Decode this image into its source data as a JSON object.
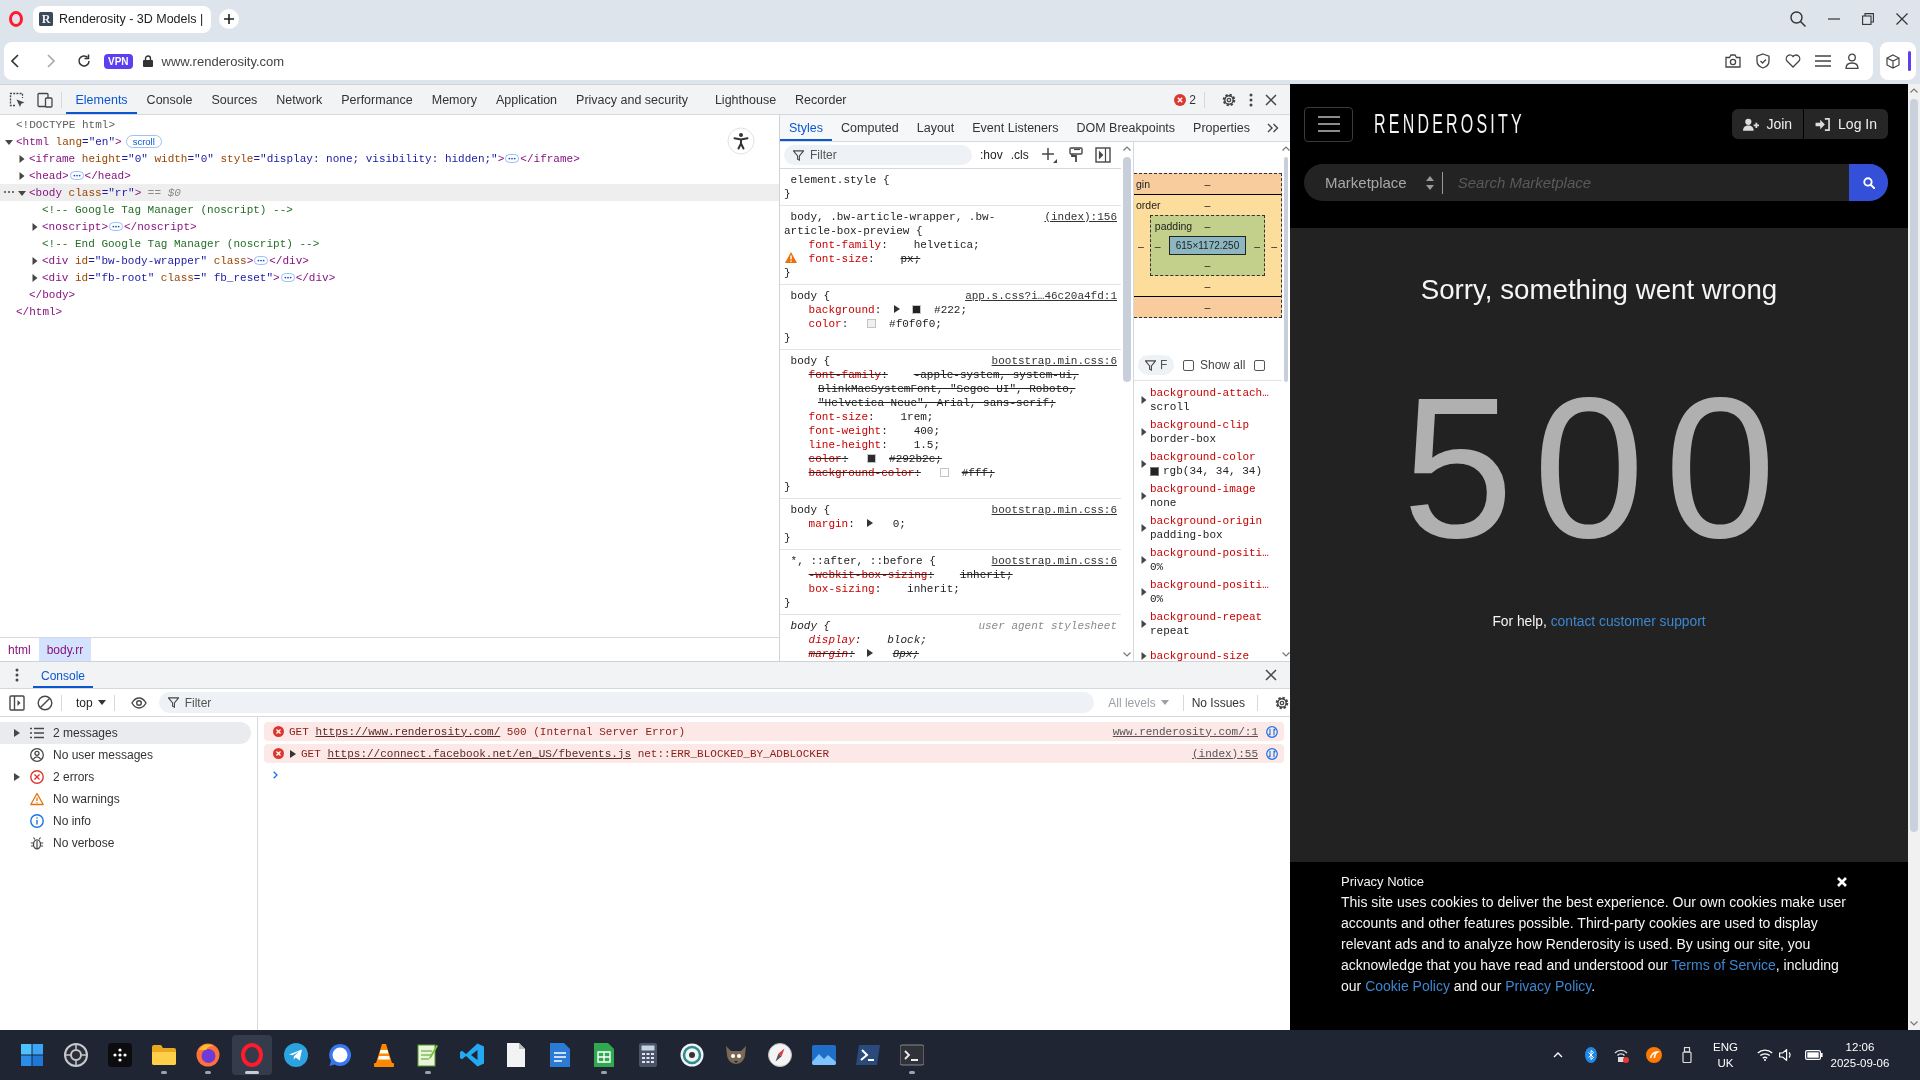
{
  "browser": {
    "tab": {
      "favicon": "R",
      "title": "Renderosity - 3D Models |"
    },
    "address_bar": {
      "vpn_badge": "VPN",
      "url": "www.renderosity.com"
    }
  },
  "devtools": {
    "tabs": [
      {
        "label": "Elements",
        "selected": true
      },
      {
        "label": "Console",
        "selected": false
      },
      {
        "label": "Sources",
        "selected": false
      },
      {
        "label": "Network",
        "selected": false
      },
      {
        "label": "Performance",
        "selected": false
      },
      {
        "label": "Memory",
        "selected": false
      },
      {
        "label": "Application",
        "selected": false
      },
      {
        "label": "Privacy and security",
        "selected": false
      },
      {
        "label": "Lighthouse",
        "selected": false
      },
      {
        "label": "Recorder",
        "selected": false
      }
    ],
    "error_count": "2",
    "dom_tree": [
      {
        "kind": "doctype",
        "selected": false,
        "tokens": [
          {
            "kind": "doctype",
            "text": "<!DOCTYPE html>"
          }
        ]
      },
      {
        "kind": "element",
        "selected": false,
        "expanded": true,
        "tokens": [
          {
            "kind": "tag",
            "text": "<html"
          },
          {
            "kind": "attr",
            "text": " lang"
          },
          {
            "kind": "value",
            "text": "=\"en\""
          },
          {
            "kind": "tag",
            "text": ">"
          }
        ],
        "badge": "scroll",
        "closing": "</html>",
        "children": [
          {
            "kind": "element",
            "selected": false,
            "expanded": false,
            "tokens": [
              {
                "kind": "tag",
                "text": "<iframe"
              },
              {
                "kind": "attr",
                "text": " height"
              },
              {
                "kind": "value",
                "text": "=\"0\""
              },
              {
                "kind": "attr",
                "text": " width"
              },
              {
                "kind": "value",
                "text": "=\"0\""
              },
              {
                "kind": "attr",
                "text": " style"
              },
              {
                "kind": "value",
                "text": "=\"display: none; visibility: hidden;\""
              },
              {
                "kind": "tag",
                "text": ">"
              }
            ],
            "closing": "</iframe>"
          },
          {
            "kind": "element",
            "selected": false,
            "expanded": false,
            "tokens": [
              {
                "kind": "tag",
                "text": "<head>"
              }
            ],
            "closing": "</head>"
          },
          {
            "kind": "element",
            "selected": true,
            "expanded": true,
            "tokens": [
              {
                "kind": "tag",
                "text": "<body"
              },
              {
                "kind": "attr",
                "text": " class"
              },
              {
                "kind": "value",
                "text": "=\"rr\""
              },
              {
                "kind": "tag",
                "text": ">"
              },
              {
                "kind": "marker",
                "text": " == $0"
              }
            ],
            "closing": "</body>",
            "children": [
              {
                "kind": "comment",
                "selected": false,
                "tokens": [
                  {
                    "kind": "comment",
                    "text": "<!-- Google Tag Manager (noscript) -->"
                  }
                ]
              },
              {
                "kind": "element",
                "selected": false,
                "expanded": false,
                "tokens": [
                  {
                    "kind": "tag",
                    "text": "<noscript>"
                  }
                ],
                "closing": "</noscript>"
              },
              {
                "kind": "comment",
                "selected": false,
                "tokens": [
                  {
                    "kind": "comment",
                    "text": "<!-- End Google Tag Manager (noscript) -->"
                  }
                ]
              },
              {
                "kind": "element",
                "selected": false,
                "expanded": false,
                "tokens": [
                  {
                    "kind": "tag",
                    "text": "<div"
                  },
                  {
                    "kind": "attr",
                    "text": " id"
                  },
                  {
                    "kind": "value",
                    "text": "=\"bw-body-wrapper\""
                  },
                  {
                    "kind": "attr",
                    "text": " class"
                  },
                  {
                    "kind": "tag",
                    "text": ">"
                  }
                ],
                "closing": "</div>"
              },
              {
                "kind": "element",
                "selected": false,
                "expanded": false,
                "tokens": [
                  {
                    "kind": "tag",
                    "text": "<div"
                  },
                  {
                    "kind": "attr",
                    "text": " id"
                  },
                  {
                    "kind": "value",
                    "text": "=\"fb-root\""
                  },
                  {
                    "kind": "attr",
                    "text": " class"
                  },
                  {
                    "kind": "value",
                    "text": "=\" fb_reset\""
                  },
                  {
                    "kind": "tag",
                    "text": ">"
                  }
                ],
                "closing": "</div>"
              }
            ]
          }
        ]
      }
    ],
    "breadcrumbs": [
      {
        "label": "html",
        "selected": false
      },
      {
        "label": "body.rr",
        "selected": true
      }
    ],
    "sidebar": {
      "tabs": [
        {
          "label": "Styles",
          "selected": true
        },
        {
          "label": "Computed",
          "selected": false
        },
        {
          "label": "Layout",
          "selected": false
        },
        {
          "label": "Event Listeners",
          "selected": false
        },
        {
          "label": "DOM Breakpoints",
          "selected": false
        },
        {
          "label": "Properties",
          "selected": false
        }
      ],
      "filter": {
        "placeholder": "Filter"
      },
      "toggles": [
        ":hov",
        ".cls"
      ],
      "rules": [
        {
          "kind": "author",
          "selector": "element.style {",
          "close": "}"
        },
        {
          "kind": "author",
          "selector": "body, .bw-article-wrapper, .bw-article-box-preview {",
          "source": "(index):156",
          "close": "}",
          "props": [
            {
              "name": "font-family",
              "sep": ":",
              "value": "helvetica;",
              "struck": false
            },
            {
              "name": "font-size",
              "sep": ":",
              "value": "px;",
              "struck": false,
              "invalid": true
            }
          ]
        },
        {
          "kind": "author",
          "selector": "body {",
          "source": "app.s.css?i…46c20a4fd:1",
          "close": "}",
          "props": [
            {
              "name": "background",
              "sep": ":",
              "value": "#222;",
              "struck": false,
              "expandable": true,
              "color": "#222222"
            },
            {
              "name": "color",
              "sep": ":",
              "value": "#f0f0f0;",
              "struck": false,
              "color": "#f0f0f0"
            }
          ]
        },
        {
          "kind": "author",
          "selector": "body {",
          "source": "bootstrap.min.css:6",
          "close": "}",
          "props": [
            {
              "name": "font-family",
              "sep": ":",
              "value": [
                "-apple-system, system-ui,",
                "BlinkMacSystemFont, \"Segoe UI\", Roboto,",
                "\"Helvetica Neue\", Arial, sans-serif;"
              ],
              "struck": true
            },
            {
              "name": "font-size",
              "sep": ":",
              "value": "1rem;",
              "struck": false
            },
            {
              "name": "font-weight",
              "sep": ":",
              "value": "400;",
              "struck": false
            },
            {
              "name": "line-height",
              "sep": ":",
              "value": "1.5;",
              "struck": false
            },
            {
              "name": "color",
              "sep": ":",
              "value": "#292b2c;",
              "struck": true,
              "color": "#292b2c"
            },
            {
              "name": "background-color",
              "sep": ":",
              "value": "#fff;",
              "struck": true,
              "color": "#ffffff"
            }
          ]
        },
        {
          "kind": "author",
          "selector": "body {",
          "source": "bootstrap.min.css:6",
          "close": "}",
          "props": [
            {
              "name": "margin",
              "sep": ":",
              "value": "0;",
              "struck": false,
              "expandable": true
            }
          ]
        },
        {
          "kind": "author",
          "selector": "*, ::after, ::before {",
          "source": "bootstrap.min.css:6",
          "close": "}",
          "props": [
            {
              "name": "-webkit-box-sizing",
              "sep": ":",
              "value": "inherit;",
              "struck": true
            },
            {
              "name": "box-sizing",
              "sep": ":",
              "value": "inherit;",
              "struck": false
            }
          ]
        },
        {
          "kind": "user_agent",
          "selector": "body {",
          "source": "user agent stylesheet",
          "props": [
            {
              "name": "display",
              "sep": ":",
              "value": "block;",
              "struck": false
            },
            {
              "name": "margin",
              "sep": ":",
              "value": "8px;",
              "struck": true,
              "expandable": true
            }
          ]
        }
      ],
      "computed": {
        "box_model": {
          "margin": {
            "label": "gin",
            "top": "–",
            "bottom": "–"
          },
          "border": {
            "label": "order",
            "top": "–",
            "left": "–",
            "right": "–",
            "bottom": "–"
          },
          "padding": {
            "label": "padding",
            "top": "–",
            "left": "–",
            "right": "–",
            "bottom": "–"
          },
          "content": "615×1172.250"
        },
        "filter": {
          "placeholder": "F"
        },
        "show_all": {
          "label": "Show all",
          "checked": false
        },
        "group": {
          "checked": false
        },
        "properties": [
          {
            "name": "background-attach…",
            "value": "scroll",
            "expanded": false
          },
          {
            "name": "background-clip",
            "value": "border-box",
            "expanded": false
          },
          {
            "name": "background-color",
            "value": "rgb(34, 34, 34)",
            "expanded": false,
            "color": "#222222"
          },
          {
            "name": "background-image",
            "value": "none",
            "expanded": false
          },
          {
            "name": "background-origin",
            "value": "padding-box",
            "expanded": false
          },
          {
            "name": "background-positi…",
            "value": "0%",
            "expanded": false
          },
          {
            "name": "background-positi…",
            "value": "0%",
            "expanded": false
          },
          {
            "name": "background-repeat",
            "value": "repeat",
            "expanded": false
          },
          {
            "name": "background-size",
            "expanded": false
          }
        ]
      }
    },
    "console_drawer": {
      "tabs": [
        {
          "label": "Console",
          "selected": true
        }
      ],
      "toolbar": {
        "context": "top",
        "filter": {
          "placeholder": "Filter"
        },
        "levels": {
          "label": "All levels",
          "disabled": true
        },
        "issues": "No Issues"
      },
      "sidebar": [
        {
          "kind": "messages",
          "label": "2 messages",
          "selected": true,
          "expandable": true
        },
        {
          "kind": "user",
          "label": "No user messages",
          "selected": false,
          "expandable": false
        },
        {
          "kind": "errors",
          "label": "2 errors",
          "selected": false,
          "expandable": true
        },
        {
          "kind": "warnings",
          "label": "No warnings",
          "selected": false,
          "expandable": false
        },
        {
          "kind": "info",
          "label": "No info",
          "selected": false,
          "expandable": false
        },
        {
          "kind": "verbose",
          "label": "No verbose",
          "selected": false,
          "expandable": false
        }
      ],
      "messages": [
        {
          "kind": "error",
          "expandable": false,
          "method": "GET",
          "url": "https://www.renderosity.com/",
          "text": "500 (Internal Server Error)",
          "source": "www.renderosity.com/:1"
        },
        {
          "kind": "error",
          "expandable": true,
          "method": "GET",
          "url": "https://connect.facebook.net/en_US/fbevents.js",
          "text": "net::ERR_BLOCKED_BY_ADBLOCKER",
          "source": "(index):55"
        }
      ]
    }
  },
  "page": {
    "header": {
      "logo": "RENDEROSITY",
      "buttons": [
        {
          "kind": "join",
          "label": "Join"
        },
        {
          "kind": "login",
          "label": "Log In"
        }
      ]
    },
    "search": {
      "category": "Marketplace",
      "placeholder": "Search Marketplace"
    },
    "error": {
      "heading": "Sorry, something went wrong",
      "code": "500",
      "help": [
        {
          "kind": "text",
          "text": "For help, "
        },
        {
          "kind": "link",
          "text": "contact customer support"
        }
      ]
    },
    "privacy_notice": {
      "title": "Privacy Notice",
      "text": [
        {
          "kind": "text",
          "text": "This site uses cookies to deliver the best experience. Our own cookies make user accounts and other features possible. Third-party cookies are used to display relevant ads and to analyze how Renderosity is used. By using our site, you acknowledge that you have read and understood our "
        },
        {
          "kind": "link",
          "text": "Terms of Service"
        },
        {
          "kind": "text",
          "text": ", including our "
        },
        {
          "kind": "link",
          "text": "Cookie Policy"
        },
        {
          "kind": "text",
          "text": " and our "
        },
        {
          "kind": "link",
          "text": "Privacy Policy"
        },
        {
          "kind": "text",
          "text": "."
        }
      ]
    }
  },
  "taskbar": {
    "apps": [
      {
        "kind": "start",
        "running": false,
        "selected": false
      },
      {
        "kind": "dial",
        "running": false,
        "selected": false
      },
      {
        "kind": "dots",
        "running": false,
        "selected": false
      },
      {
        "kind": "folder",
        "running": true,
        "selected": false
      },
      {
        "kind": "globe",
        "running": true,
        "selected": false
      },
      {
        "kind": "ring",
        "running": true,
        "selected": true
      },
      {
        "kind": "plane",
        "running": false,
        "selected": false
      },
      {
        "kind": "bubble",
        "running": false,
        "selected": false
      },
      {
        "kind": "cone",
        "running": false,
        "selected": false
      },
      {
        "kind": "notepad",
        "running": true,
        "selected": false
      },
      {
        "kind": "code",
        "running": false,
        "selected": false
      },
      {
        "kind": "file",
        "running": false,
        "selected": false
      },
      {
        "kind": "doc",
        "running": false,
        "selected": false
      },
      {
        "kind": "sheet",
        "running": true,
        "selected": false
      },
      {
        "kind": "calculator",
        "running": false,
        "selected": false
      },
      {
        "kind": "emblem",
        "running": false,
        "selected": false
      },
      {
        "kind": "animal",
        "running": false,
        "selected": false
      },
      {
        "kind": "compass",
        "running": false,
        "selected": false
      },
      {
        "kind": "picture",
        "running": false,
        "selected": false
      },
      {
        "kind": "shell",
        "running": false,
        "selected": false
      },
      {
        "kind": "terminal",
        "running": true,
        "selected": false
      }
    ],
    "tray": {
      "language": "ENG",
      "region": "UK",
      "time": "12:06",
      "date": "2025-09-06"
    }
  }
}
